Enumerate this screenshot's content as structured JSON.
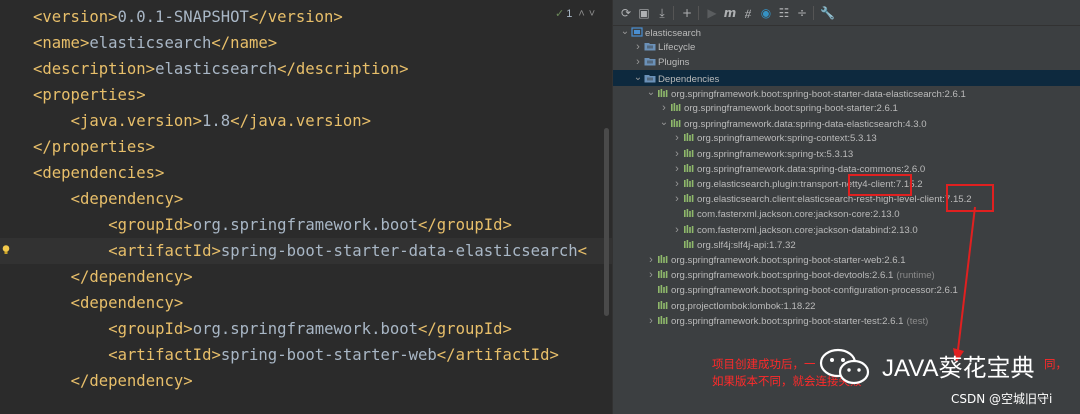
{
  "editor": {
    "inspection": {
      "check": "✓",
      "count": "1"
    },
    "lines": [
      {
        "indent": 1,
        "open": "<version>",
        "text": "0.0.1-SNAPSHOT",
        "close": "</version>"
      },
      {
        "indent": 1,
        "open": "<name>",
        "text": "elasticsearch",
        "close": "</name>"
      },
      {
        "indent": 1,
        "open": "<description>",
        "text": "elasticsearch",
        "close": "</description>"
      },
      {
        "indent": 1,
        "open": "<properties>",
        "text": "",
        "close": ""
      },
      {
        "indent": 2,
        "open": "<java.version>",
        "text": "1.8",
        "close": "</java.version>"
      },
      {
        "indent": 1,
        "open": "</properties>",
        "text": "",
        "close": ""
      },
      {
        "indent": 1,
        "open": "<dependencies>",
        "text": "",
        "close": ""
      },
      {
        "indent": 2,
        "open": "<dependency>",
        "text": "",
        "close": ""
      },
      {
        "indent": 3,
        "open": "<groupId>",
        "text": "org.springframework.boot",
        "close": "</groupId>"
      },
      {
        "indent": 3,
        "open": "<artifactId>",
        "text": "spring-boot-starter-data-elasticsearch",
        "close": "<"
      },
      {
        "indent": 2,
        "open": "</dependency>",
        "text": "",
        "close": ""
      },
      {
        "indent": 2,
        "open": "<dependency>",
        "text": "",
        "close": ""
      },
      {
        "indent": 3,
        "open": "<groupId>",
        "text": "org.springframework.boot",
        "close": "</groupId>"
      },
      {
        "indent": 3,
        "open": "<artifactId>",
        "text": "spring-boot-starter-web",
        "close": "</artifactId>"
      },
      {
        "indent": 2,
        "open": "</dependency>",
        "text": "",
        "close": ""
      }
    ]
  },
  "maven": {
    "toolbar_icons": [
      "refresh-icon",
      "generate-sources-icon",
      "download-icon",
      "add-icon",
      "run-icon",
      "maven-goal-icon",
      "skip-tests-icon",
      "offline-icon",
      "show-dependencies-icon",
      "collapse-all-icon",
      "settings-icon"
    ],
    "tree": [
      {
        "level": 0,
        "expand": "open",
        "icon": "maven",
        "label": "elasticsearch",
        "scope": ""
      },
      {
        "level": 1,
        "expand": "closed",
        "icon": "folder",
        "label": "Lifecycle",
        "scope": ""
      },
      {
        "level": 1,
        "expand": "closed",
        "icon": "folder",
        "label": "Plugins",
        "scope": ""
      },
      {
        "level": 1,
        "expand": "open",
        "icon": "folder",
        "label": "Dependencies",
        "scope": "",
        "selected": true
      },
      {
        "level": 2,
        "expand": "open",
        "icon": "lib",
        "label": "org.springframework.boot:spring-boot-starter-data-elasticsearch:2.6.1",
        "scope": ""
      },
      {
        "level": 3,
        "expand": "closed",
        "icon": "lib",
        "label": "org.springframework.boot:spring-boot-starter:2.6.1",
        "scope": ""
      },
      {
        "level": 3,
        "expand": "open",
        "icon": "lib",
        "label": "org.springframework.data:spring-data-elasticsearch:4.3.0",
        "scope": ""
      },
      {
        "level": 4,
        "expand": "closed",
        "icon": "lib",
        "label": "org.springframework:spring-context:5.3.13",
        "scope": ""
      },
      {
        "level": 4,
        "expand": "closed",
        "icon": "lib",
        "label": "org.springframework:spring-tx:5.3.13",
        "scope": ""
      },
      {
        "level": 4,
        "expand": "closed",
        "icon": "lib",
        "label": "org.springframework.data:spring-data-commons:2.6.0",
        "scope": ""
      },
      {
        "level": 4,
        "expand": "closed",
        "icon": "lib",
        "label": "org.elasticsearch.plugin:transport-netty4-client:7.15.2",
        "scope": ""
      },
      {
        "level": 4,
        "expand": "closed",
        "icon": "lib",
        "label": "org.elasticsearch.client:elasticsearch-rest-high-level-client:7.15.2",
        "scope": ""
      },
      {
        "level": 4,
        "expand": "none",
        "icon": "lib",
        "label": "com.fasterxml.jackson.core:jackson-core:2.13.0",
        "scope": ""
      },
      {
        "level": 4,
        "expand": "closed",
        "icon": "lib",
        "label": "com.fasterxml.jackson.core:jackson-databind:2.13.0",
        "scope": ""
      },
      {
        "level": 4,
        "expand": "none",
        "icon": "lib",
        "label": "org.slf4j:slf4j-api:1.7.32",
        "scope": ""
      },
      {
        "level": 2,
        "expand": "closed",
        "icon": "lib",
        "label": "org.springframework.boot:spring-boot-starter-web:2.6.1",
        "scope": ""
      },
      {
        "level": 2,
        "expand": "closed",
        "icon": "lib",
        "label": "org.springframework.boot:spring-boot-devtools:2.6.1",
        "scope": "(runtime)"
      },
      {
        "level": 2,
        "expand": "none",
        "icon": "lib",
        "label": "org.springframework.boot:spring-boot-configuration-processor:2.6.1",
        "scope": ""
      },
      {
        "level": 2,
        "expand": "none",
        "icon": "lib",
        "label": "org.projectlombok:lombok:1.18.22",
        "scope": ""
      },
      {
        "level": 2,
        "expand": "closed",
        "icon": "lib",
        "label": "org.springframework.boot:spring-boot-starter-test:2.6.1",
        "scope": "(test)"
      }
    ]
  },
  "annotation": {
    "note_line1_a": "项目创建成功后，一",
    "note_line1_b": "同，",
    "note_line2": "如果版本不同，就会连接失败",
    "highlight_color": "#e02020"
  },
  "watermark": {
    "brand": "JAVA葵花宝典",
    "credit": "CSDN @空城旧守i"
  }
}
